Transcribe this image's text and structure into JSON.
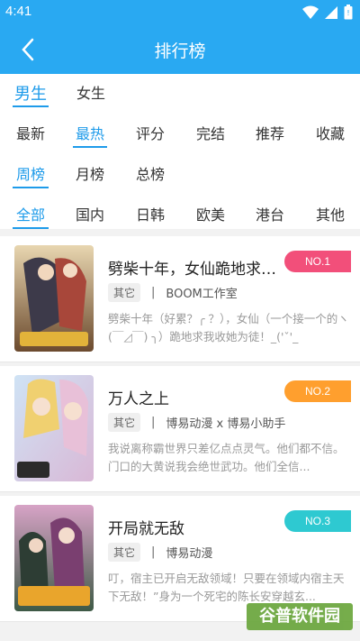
{
  "status": {
    "time": "4:41"
  },
  "header": {
    "title": "排行榜"
  },
  "filters": {
    "gender": [
      "男生",
      "女生"
    ],
    "sort": [
      "最新",
      "最热",
      "评分",
      "完结",
      "推荐",
      "收藏"
    ],
    "period": [
      "周榜",
      "月榜",
      "总榜"
    ],
    "region": [
      "全部",
      "国内",
      "日韩",
      "欧美",
      "港台",
      "其他"
    ]
  },
  "colors": {
    "primary": "#29a9f2",
    "rank1": "#f24f7a",
    "rank2": "#ff9f2e",
    "rank3": "#2ec9d1"
  },
  "list": [
    {
      "title": "劈柴十年，女仙跪地求我...",
      "rank": "NO.1",
      "tag": "其它",
      "author": "BOOM工作室",
      "desc": "劈柴十年（好累？╭ ？），女仙（一个接一个的ヽ(￣◿￣) ╮）跪地求我收她为徒！_('ˇ'_"
    },
    {
      "title": "万人之上",
      "rank": "NO.2",
      "tag": "其它",
      "author": "博易动漫 x 博易小助手",
      "desc": "我说离称霸世界只差亿点点灵气。他们都不信。门口的大黄说我会绝世武功。他们全信..."
    },
    {
      "title": "开局就无敌",
      "rank": "NO.3",
      "tag": "其它",
      "author": "博易动漫",
      "desc": "叮，宿主已开启无敌领域！只要在领域内宿主天下无敌！”身为一个死宅的陈长安穿越玄..."
    }
  ],
  "watermark": "谷普软件园"
}
